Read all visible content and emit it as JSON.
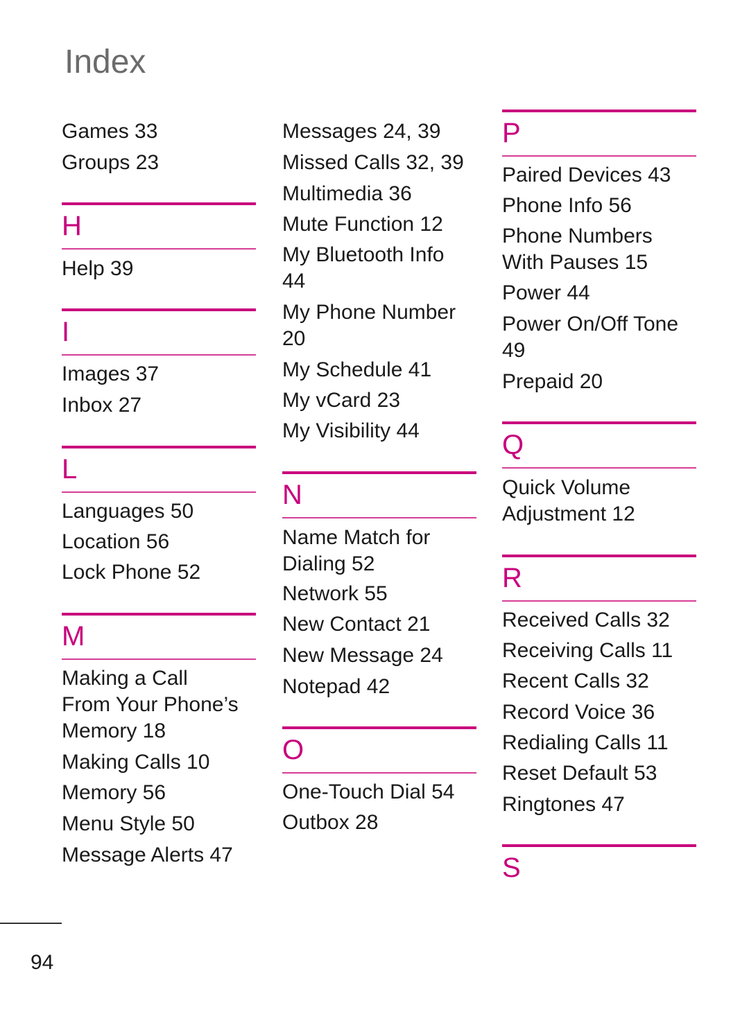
{
  "page": {
    "title": "Index",
    "page_number": "94"
  },
  "accent_color": "#c8007d",
  "columns": [
    {
      "entries_top": [
        "Games 33",
        "Groups 23"
      ],
      "sections": [
        {
          "letter": "H",
          "entries": [
            "Help 39"
          ]
        },
        {
          "letter": "I",
          "entries": [
            "Images 37",
            "Inbox 27"
          ]
        },
        {
          "letter": "L",
          "entries": [
            "Languages 50",
            "Location 56",
            "Lock Phone 52"
          ]
        },
        {
          "letter": "M",
          "entries": [
            "Making a Call From Your Phone’s Memory 18",
            "Making Calls 10",
            "Memory 56",
            "Menu Style 50",
            "Message Alerts 47"
          ]
        }
      ]
    },
    {
      "entries_top": [
        "Messages 24, 39",
        "Missed Calls 32, 39",
        "Multimedia 36",
        "Mute Function 12",
        "My Bluetooth Info 44",
        "My Phone Number 20",
        "My Schedule 41",
        "My vCard 23",
        "My Visibility 44"
      ],
      "sections": [
        {
          "letter": "N",
          "entries": [
            "Name Match for Dialing 52",
            "Network 55",
            "New Contact 21",
            "New Message 24",
            "Notepad 42"
          ]
        },
        {
          "letter": "O",
          "entries": [
            "One-Touch Dial 54",
            "Outbox 28"
          ]
        }
      ]
    },
    {
      "sections": [
        {
          "letter": "P",
          "entries": [
            "Paired Devices 43",
            "Phone Info 56",
            "Phone Numbers With Pauses 15",
            "Power 44",
            "Power On/Off Tone 49",
            "Prepaid 20"
          ]
        },
        {
          "letter": "Q",
          "entries": [
            "Quick Volume Adjustment 12"
          ]
        },
        {
          "letter": "R",
          "entries": [
            "Received Calls 32",
            "Receiving Calls 11",
            "Recent Calls 32",
            "Record Voice 36",
            "Redialing Calls 11",
            "Reset Default 53",
            "Ringtones 47"
          ]
        },
        {
          "letter": "S",
          "entries": []
        }
      ]
    }
  ]
}
